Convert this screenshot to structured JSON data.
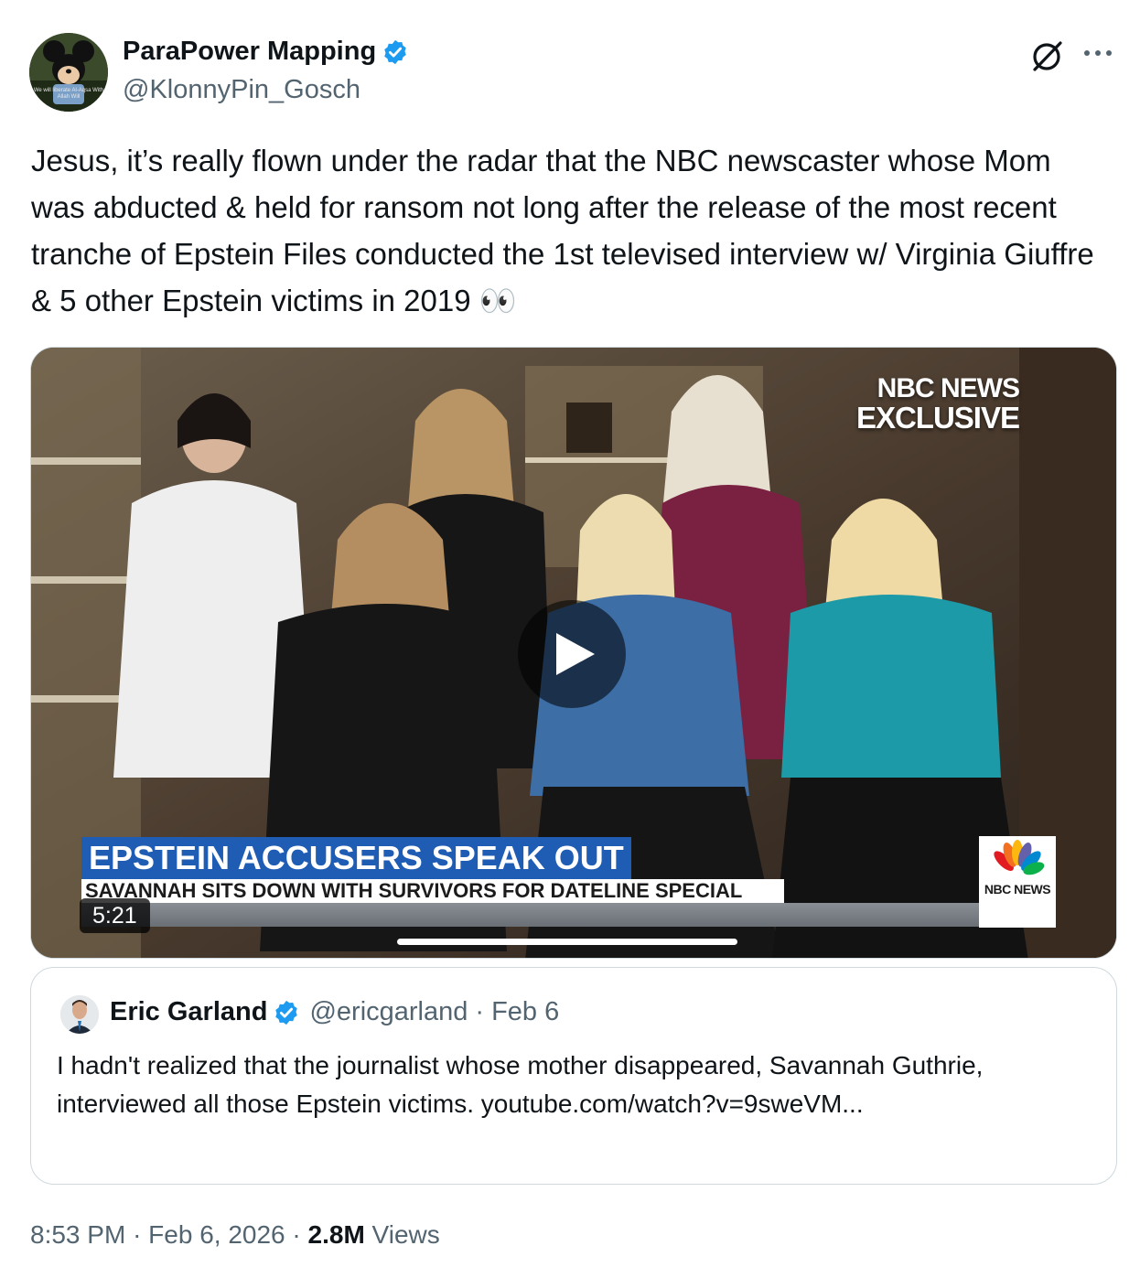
{
  "tweet": {
    "author_name": "ParaPower Mapping",
    "author_handle": "@KlonnyPin_Gosch",
    "avatar_caption": "We will liberate Al-Aqsa With Allah Will",
    "text": "Jesus, it’s really flown under the radar that the NBC newscaster whose Mom was abducted & held for ransom not long after the release of the most recent tranche of Epstein Files conducted the 1st televised interview w/ Virginia Giuffre & 5 other Epstein victims in 2019 👀",
    "time": "8:53 PM",
    "sep": "·",
    "date": "Feb 6, 2026",
    "views_count": "2.8M",
    "views_label": "Views"
  },
  "video": {
    "network_line1": "NBC NEWS",
    "network_line2": "EXCLUSIVE",
    "headline": "EPSTEIN ACCUSERS SPEAK OUT",
    "subheadline": "SAVANNAH SITS DOWN WITH SURVIVORS FOR DATELINE SPECIAL",
    "badge_label": "NBC NEWS",
    "duration": "5:21"
  },
  "quote": {
    "author_name": "Eric Garland",
    "author_handle": "@ericgarland",
    "sep": "·",
    "date": "Feb 6",
    "text": "I hadn't realized that the journalist whose mother disappeared, Savannah Guthrie, interviewed all those Epstein victims. youtube.com/watch?v=9sweVM..."
  },
  "colors": {
    "verified": "#1d9bf0",
    "secondary_text": "#536471",
    "primary_text": "#0f1419",
    "chyron_blue": "#1f5cb4"
  },
  "icons": [
    "verified-badge-icon",
    "grok-icon",
    "more-icon",
    "play-icon",
    "peacock-icon"
  ]
}
